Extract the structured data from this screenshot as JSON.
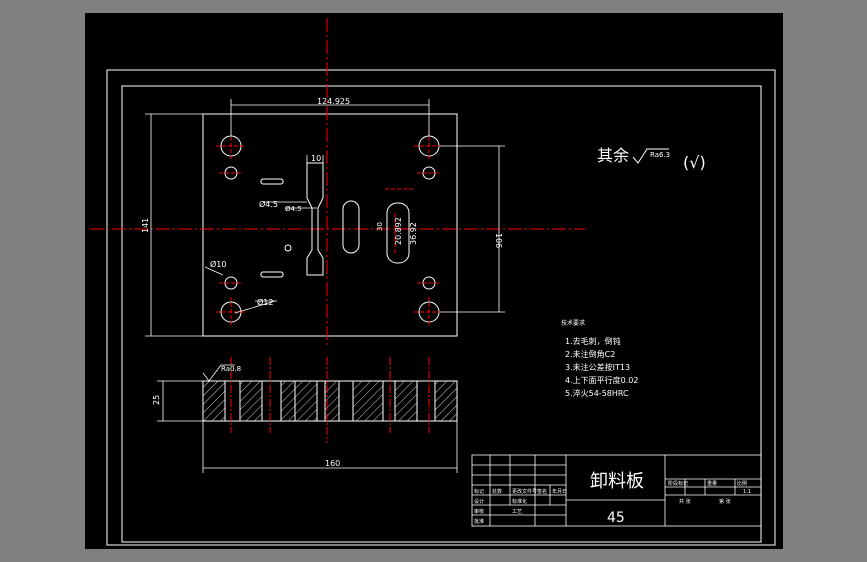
{
  "drawing": {
    "part_name": "卸料板",
    "material": "45",
    "surface_roughness_default": "其余",
    "roughness_value_general": "Ra6.3",
    "check_mark": "(√)",
    "roughness_value_top": "Ra0.8"
  },
  "dimensions": {
    "hole_spacing_horizontal": "124.925",
    "plate_height": "141",
    "hole_spacing_vertical": "106",
    "slot_width": "10",
    "small_hole_diameter": "Ø4.5",
    "small_hole_diameter_2": "Ø4.5",
    "guide_hole_diameter": "Ø10",
    "large_hole_diameter": "Ø12",
    "slot_length_1": "20.892",
    "slot_length_2": "36.92",
    "slot_offset": "30",
    "plate_thickness": "25",
    "plate_width": "160"
  },
  "notes": {
    "heading": "技术要求",
    "items": [
      "1.去毛刺，倒钝",
      "2.未注倒角C2",
      "3.未注公差按IT13",
      "4.上下面平行度0.02",
      "5.淬火54-58HRC"
    ]
  },
  "title_block": {
    "left_cells": [
      "标记",
      "处数",
      "分区",
      "更改文件号",
      "签名",
      "年月日",
      "设计",
      "标准化",
      "审核",
      "工艺",
      "批准"
    ],
    "right_cells": [
      "阶段标记",
      "重量",
      "比例",
      "1:1",
      "共 张",
      "第 张"
    ]
  },
  "colors": {
    "background": "#000000",
    "window": "#808080",
    "border": "#ffffff",
    "centerline": "#ff0000",
    "geometry": "#ffffff",
    "hatch": "#ffffff",
    "dimension": "#ffffff"
  }
}
